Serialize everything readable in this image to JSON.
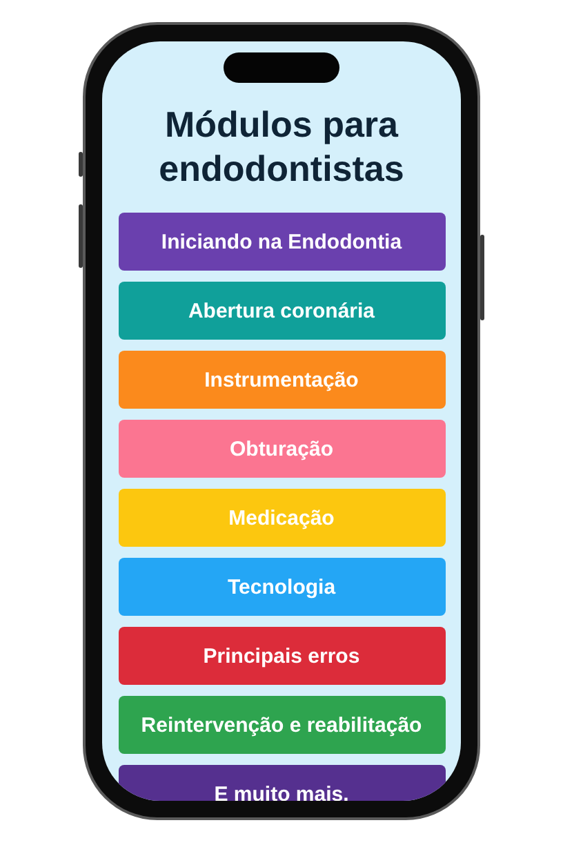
{
  "title": "Módulos para endodontistas",
  "modules": [
    {
      "label": "Iniciando na Endodontia",
      "color": "#6a40ae"
    },
    {
      "label": "Abertura coronária",
      "color": "#10a09a"
    },
    {
      "label": "Instrumentação",
      "color": "#fb8a1c"
    },
    {
      "label": "Obturação",
      "color": "#fb7591"
    },
    {
      "label": "Medicação",
      "color": "#fcc70f"
    },
    {
      "label": "Tecnologia",
      "color": "#24a6f5"
    },
    {
      "label": "Principais erros",
      "color": "#dc2c3a"
    },
    {
      "label": "Reintervenção e reabilitação",
      "color": "#2ea44f"
    },
    {
      "label": "E muito mais.",
      "color": "#55308f"
    }
  ]
}
